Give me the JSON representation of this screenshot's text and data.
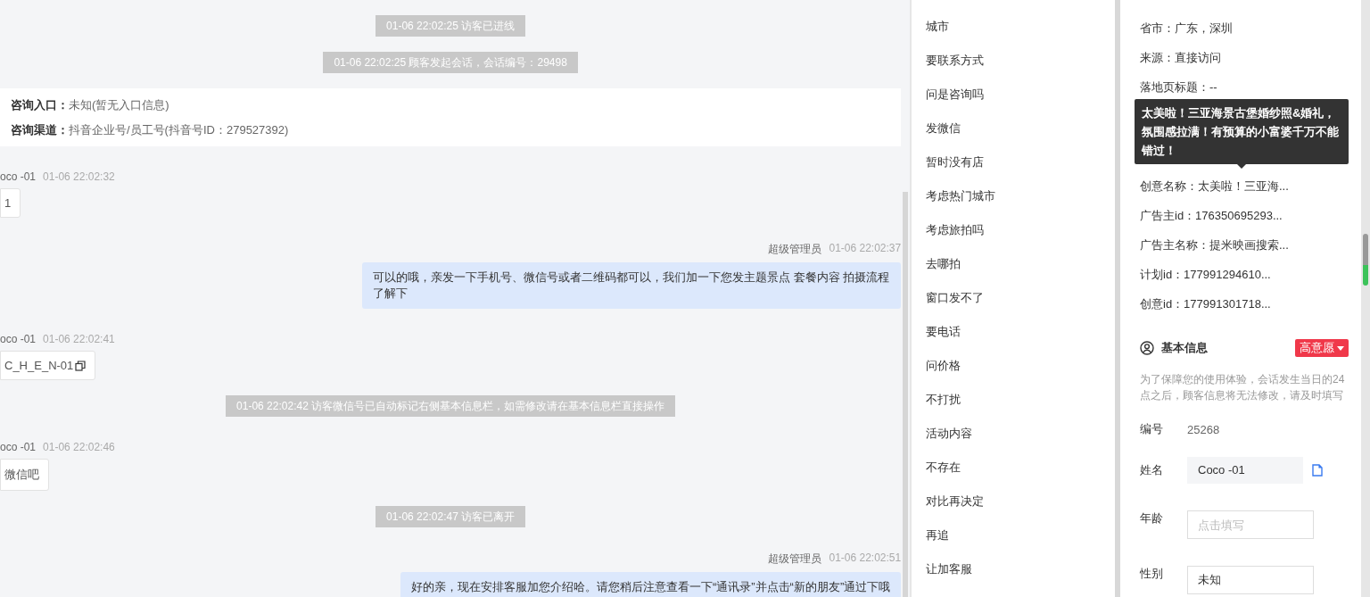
{
  "chat": {
    "messages": [
      {
        "kind": "system",
        "text": "01-06 22:02:25 访客已进线"
      },
      {
        "kind": "system",
        "text": "01-06 22:02:25 顾客发起会话，会话编号：29498"
      },
      {
        "kind": "info",
        "entries": [
          {
            "label": "咨询入口：",
            "value": "未知(暂无入口信息)"
          },
          {
            "label": "咨询渠道：",
            "value": "抖音企业号/员工号(抖音号ID：279527392)"
          }
        ]
      },
      {
        "kind": "visitor",
        "sender": "oco -01",
        "time": "01-06 22:02:32",
        "text": "1",
        "copyable": false
      },
      {
        "kind": "agent",
        "sender": "超级管理员",
        "time": "01-06 22:02:37",
        "text": "可以的哦，亲发一下手机号、微信号或者二维码都可以，我们加一下您发主题景点 套餐内容 拍摄流程了解下"
      },
      {
        "kind": "visitor",
        "sender": "oco -01",
        "time": "01-06 22:02:41",
        "text": "C_H_E_N-01",
        "copyable": true
      },
      {
        "kind": "system",
        "text": "01-06 22:02:42 访客微信号已自动标记右侧基本信息栏，如需修改请在基本信息栏直接操作"
      },
      {
        "kind": "visitor",
        "sender": "oco -01",
        "time": "01-06 22:02:46",
        "text": "微信吧",
        "copyable": false
      },
      {
        "kind": "system",
        "text": "01-06 22:02:47 访客已离开"
      },
      {
        "kind": "agent",
        "sender": "超级管理员",
        "time": "01-06 22:02:51",
        "text": "好的亲，现在安排客服加您介绍哈。请您稍后注意查看一下“通讯录”并点击“新的朋友”通过下哦"
      }
    ]
  },
  "quick_replies": [
    "城市",
    "要联系方式",
    "问是咨询吗",
    "发微信",
    "暂时没有店",
    "考虑热门城市",
    "考虑旅拍吗",
    "去哪拍",
    "窗口发不了",
    "要电话",
    "问价格",
    "不打扰",
    "活动内容",
    "不存在",
    "对比再决定",
    "再追",
    "让加客服"
  ],
  "details": {
    "rows": [
      {
        "text": "省市：广东，深圳"
      },
      {
        "text": "来源：直接访问"
      },
      {
        "text": "落地页标题：--"
      }
    ],
    "rows_below": [
      {
        "text": "创意名称：太美啦！三亚海..."
      },
      {
        "text": "广告主id：176350695293..."
      },
      {
        "text": "广告主名称：提米映画搜索..."
      },
      {
        "text": "计划id：177991294610..."
      },
      {
        "text": "创意id：177991301718..."
      }
    ],
    "tooltip": "太美啦！三亚海景古堡婚纱照&婚礼，氛围感拉满！有预算的小富婆千万不能错过！"
  },
  "basic_info": {
    "title": "基本信息",
    "intent_tag": "高意愿",
    "notice": "为了保障您的使用体验，会话发生当日的24点之后，顾客信息将无法修改，请及时填写",
    "fields": [
      {
        "kind": "text",
        "label": "编号",
        "value": "25268"
      },
      {
        "kind": "readonly",
        "label": "姓名",
        "value": "Coco -01"
      },
      {
        "kind": "input",
        "label": "年龄",
        "placeholder": "点击填写"
      },
      {
        "kind": "input",
        "label": "性别",
        "value": "未知"
      }
    ]
  }
}
